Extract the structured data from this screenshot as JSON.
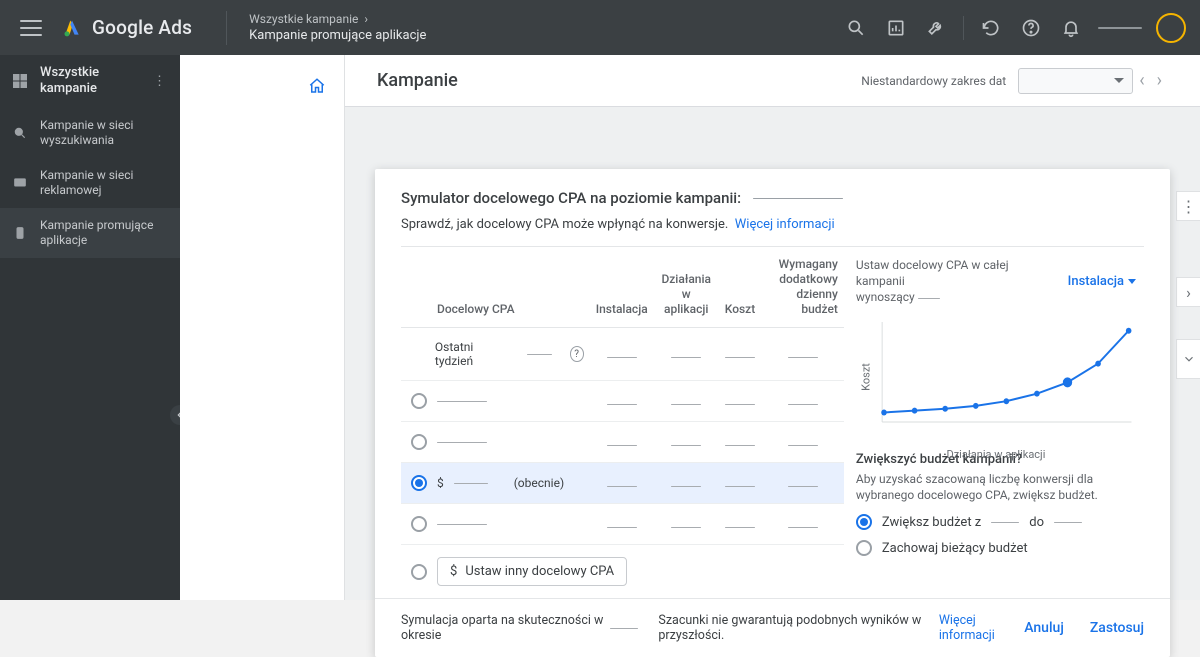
{
  "app": {
    "name": "Google Ads"
  },
  "breadcrumb": {
    "top": "Wszystkie kampanie",
    "bottom": "Kampanie promujące aplikacje"
  },
  "sidebar": {
    "heading": "Wszystkie kampanie",
    "items": [
      {
        "label": "Kampanie w sieci wyszukiwania"
      },
      {
        "label": "Kampanie w sieci reklamowej"
      },
      {
        "label": "Kampanie promujące aplikacje"
      }
    ]
  },
  "page": {
    "title": "Kampanie",
    "date_label": "Niestandardowy zakres dat"
  },
  "simulator": {
    "title": "Symulator docelowego CPA na poziomie kampanii:",
    "subtitle": "Sprawdź, jak docelowy CPA może wpłynąć na konwersje.",
    "more_info": "Więcej informacji",
    "columns": {
      "cpa": "Docelowy CPA",
      "install": "Instalacja",
      "inapp_1": "Działania",
      "inapp_2": "w aplikacji",
      "cost": "Koszt",
      "budget_1": "Wymagany",
      "budget_2": "dodatkowy",
      "budget_3": "dzienny budżet"
    },
    "last_week": "Ostatni tydzień",
    "current_suffix": "(obecnie)",
    "currency": "$",
    "custom_btn": "Ustaw inny docelowy CPA",
    "right": {
      "title_a": "Ustaw docelowy CPA w całej kampanii",
      "title_b": "wynoszący",
      "metric": "Instalacja",
      "y": "Koszt",
      "x": "Działania w aplikacji"
    },
    "increase": {
      "title": "Zwiększyć budżet kampanii?",
      "sub": "Aby uzyskać szacowaną liczbę konwersji dla wybranego docelowego CPA, zwiększ budżet.",
      "opt1_a": "Zwiększ budżet z",
      "opt1_b": "do",
      "opt2": "Zachowaj bieżący budżet"
    },
    "footer": {
      "period": "Symulacja oparta na skuteczności w okresie",
      "disclaimer": "Szacunki nie gwarantują podobnych wyników w przyszłości.",
      "more": "Więcej informacji",
      "cancel": "Anuluj",
      "apply": "Zastosuj"
    }
  },
  "chart_data": {
    "type": "line",
    "title": "Ustaw docelowy CPA w całej kampanii wynoszący —",
    "xlabel": "Działania w aplikacji",
    "ylabel": "Koszt",
    "x": [
      0,
      1,
      2,
      3,
      4,
      5,
      6,
      7,
      8
    ],
    "values": [
      8,
      10,
      12,
      15,
      20,
      28,
      40,
      60,
      95
    ],
    "highlight_index": 6,
    "ylim": [
      0,
      100
    ]
  }
}
